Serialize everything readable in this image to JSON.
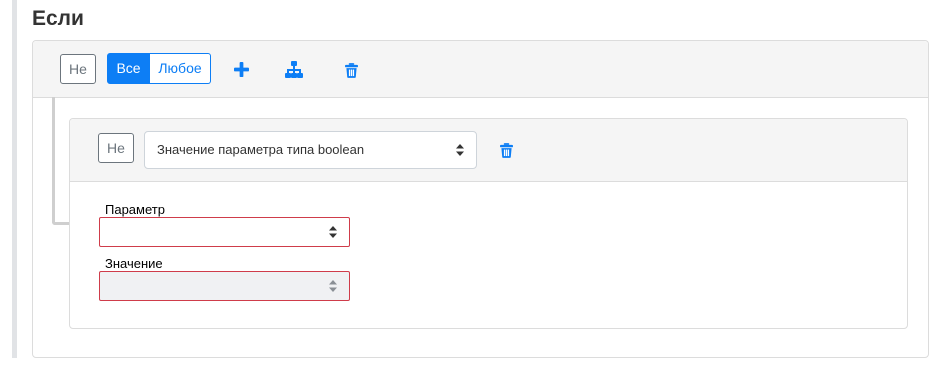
{
  "heading": "Если",
  "group": {
    "not_label": "Не",
    "conjunction": {
      "all_label": "Все",
      "any_label": "Любое",
      "selected": "all"
    },
    "icons": [
      "plus-icon",
      "sitemap-icon",
      "trash-icon"
    ]
  },
  "rule": {
    "not_label": "Не",
    "type_select_value": "Значение параметра типа boolean",
    "param_label": "Параметр",
    "param_value": "",
    "value_label": "Значение",
    "value_value": ""
  },
  "colors": {
    "accent": "#0d7ef5",
    "invalid_border": "#cf3c4a",
    "panel_bg": "#f5f5f5",
    "disabled_bg": "#f0f1f3"
  }
}
